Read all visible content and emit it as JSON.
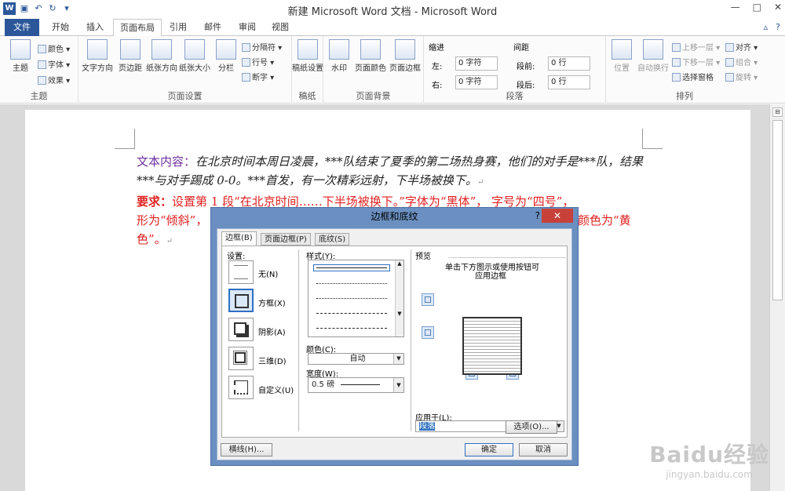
{
  "window": {
    "title": "新建 Microsoft Word 文档 - Microsoft Word",
    "logo": "W"
  },
  "ribbon_tabs": [
    "文件",
    "开始",
    "插入",
    "页面布局",
    "引用",
    "邮件",
    "审阅",
    "视图"
  ],
  "groups": {
    "theme": {
      "label": "主题",
      "big": "主题",
      "colors": "颜色",
      "fonts": "字体",
      "effects": "效果"
    },
    "page_setup": {
      "label": "页面设置",
      "text_direction": "文字方向",
      "margins": "页边距",
      "orientation": "纸张方向",
      "size": "纸张大小",
      "columns": "分栏",
      "breaks": "分隔符",
      "line_numbers": "行号",
      "hyphenation": "断字"
    },
    "manuscript": {
      "label": "稿纸",
      "btn": "稿纸设置"
    },
    "page_bg": {
      "label": "页面背景",
      "watermark": "水印",
      "page_color": "页面颜色",
      "page_border": "页面边框"
    },
    "paragraph": {
      "label": "段落",
      "indent": "缩进",
      "left": "左:",
      "left_value": "0 字符",
      "right": "右:",
      "right_value": "0 字符",
      "spacing": "间距",
      "before": "段前:",
      "before_value": "0 行",
      "after": "段后:",
      "after_value": "0 行"
    },
    "arrange": {
      "label": "排列",
      "position": "位置",
      "wrap": "自动换行",
      "bring_forward": "上移一层",
      "send_backward": "下移一层",
      "selection_pane": "选择窗格",
      "align": "对齐",
      "group": "组合",
      "rotate": "旋转"
    }
  },
  "document": {
    "p1_label": "文本内容：",
    "p1_text": "在北京时间本周日凌晨，***队结束了夏季的第二场热身赛，他们的对手是***队，结果***与对手踢成 0-0。***首发，有一次精彩远射，下半场被换下。",
    "p2_label": "要求：",
    "p2_line1": "设置第 1 段“在北京时间……下半场被换下。”字体为“黑体”，     字号为“四号”，",
    "p2_line2a": "形为“倾斜”，",
    "p2_line2b": "颜色为“黄",
    "p2_line3": "色”。",
    "para_mark": "↵"
  },
  "dialog": {
    "title": "边框和底纹",
    "help": "?",
    "close": "✕",
    "tabs": [
      "边框(B)",
      "页面边框(P)",
      "底纹(S)"
    ],
    "settings_label": "设置:",
    "settings": [
      "无(N)",
      "方框(X)",
      "阴影(A)",
      "三维(D)",
      "自定义(U)"
    ],
    "style_label": "样式(Y):",
    "color_label": "颜色(C):",
    "color_value": "自动",
    "width_label": "宽度(W):",
    "width_value": "0.5 磅",
    "preview_label": "预览",
    "preview_hint_1": "单击下方图示或使用按钮可",
    "preview_hint_2": "应用边框",
    "apply_label": "应用于(L):",
    "apply_value": "段落",
    "options_btn": "选项(O)...",
    "hline_btn": "横线(H)...",
    "ok_btn": "确定",
    "cancel_btn": "取消"
  },
  "watermark": {
    "line1": "Baidu经验",
    "line2": "jingyan.baidu.com"
  }
}
